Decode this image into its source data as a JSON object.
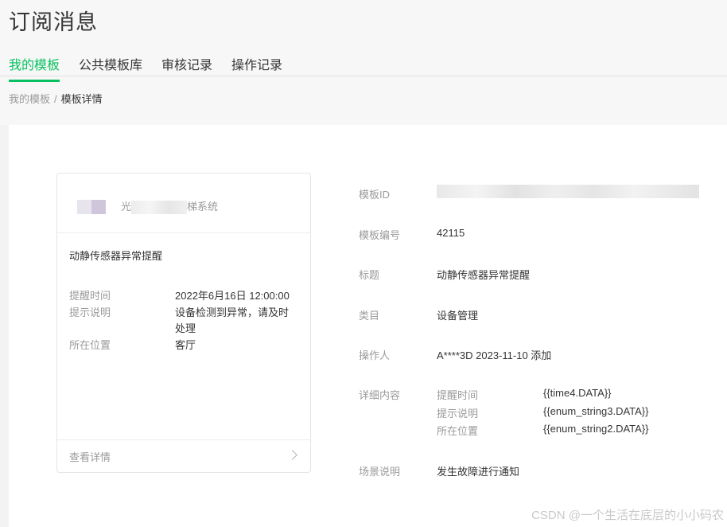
{
  "page": {
    "title": "订阅消息",
    "tabs": [
      {
        "label": "我的模板"
      },
      {
        "label": "公共模板库"
      },
      {
        "label": "审核记录"
      },
      {
        "label": "操作记录"
      }
    ],
    "breadcrumb": {
      "parent": "我的模板",
      "separator": "/",
      "current": "模板详情"
    }
  },
  "preview": {
    "account_prefix": "光",
    "account_suffix": "梯系统",
    "title": "动静传感器异常提醒",
    "fields": [
      {
        "label": "提醒时间",
        "value": "2022年6月16日 12:00:00"
      },
      {
        "label": "提示说明",
        "value": "设备检测到异常，请及时处理"
      },
      {
        "label": "所在位置",
        "value": "客厅"
      }
    ],
    "footer_link": "查看详情"
  },
  "details": {
    "template_id_label": "模板ID",
    "template_no_label": "模板编号",
    "template_no": "42115",
    "title_label": "标题",
    "title": "动静传感器异常提醒",
    "category_label": "类目",
    "category": "设备管理",
    "operator_label": "操作人",
    "operator": "A****3D 2023-11-10 添加",
    "content_label": "详细内容",
    "content": [
      {
        "key": "提醒时间",
        "value": "{{time4.DATA}}"
      },
      {
        "key": "提示说明",
        "value": "{{enum_string3.DATA}}"
      },
      {
        "key": "所在位置",
        "value": "{{enum_string2.DATA}}"
      }
    ],
    "scene_label": "场景说明",
    "scene": "发生故障进行通知"
  },
  "watermark": "CSDN @一个生活在底层的小小码农",
  "colors": {
    "accent": "#07c160",
    "muted": "#9a9a9a",
    "text": "#353535"
  }
}
